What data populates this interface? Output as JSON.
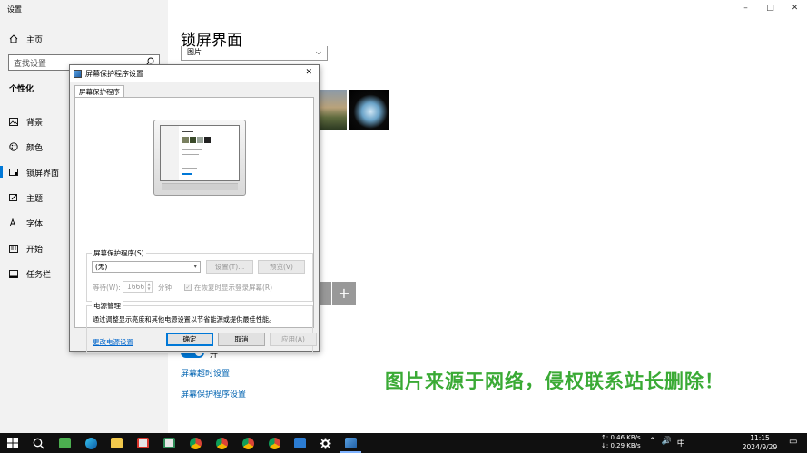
{
  "settings": {
    "window_title": "设置",
    "home": "主页",
    "search_placeholder": "查找设置",
    "section": "个性化",
    "nav": [
      {
        "label": "背景",
        "icon": "image-icon"
      },
      {
        "label": "颜色",
        "icon": "palette-icon"
      },
      {
        "label": "锁屏界面",
        "icon": "lock-screen-icon",
        "active": true
      },
      {
        "label": "主题",
        "icon": "brush-icon"
      },
      {
        "label": "字体",
        "icon": "font-icon"
      },
      {
        "label": "开始",
        "icon": "start-icon"
      },
      {
        "label": "任务栏",
        "icon": "taskbar-icon"
      }
    ],
    "page_title": "锁屏界面",
    "background_value": "图片",
    "toggle_label": "开",
    "link_timeout": "屏幕超时设置",
    "link_screensaver": "屏幕保护程序设置",
    "window_controls": {
      "minimize": "–",
      "maximize": "□",
      "close": "✕"
    }
  },
  "dialog": {
    "title": "屏幕保护程序设置",
    "close": "✕",
    "tab": "屏幕保护程序",
    "screensaver_group": "屏幕保护程序(S)",
    "screensaver_value": "(无)",
    "settings_button": "设置(T)...",
    "preview_button": "预览(V)",
    "wait_label": "等待(W):",
    "wait_value": "1666",
    "wait_unit": "分钟",
    "logon_label": "在恢复时显示登录屏幕(R)",
    "power_group": "电源管理",
    "power_desc": "通过调整显示亮度和其他电源设置以节省能源或提供最佳性能。",
    "power_link": "更改电源设置",
    "ok": "确定",
    "cancel": "取消",
    "apply": "应用(A)"
  },
  "watermark": "图片来源于网络，侵权联系站长删除！",
  "taskbar": {
    "net_up": "↑: 0.46 KB/s",
    "net_down": "↓: 0.29 KB/s",
    "tray": [
      "^",
      "🔊",
      "中"
    ],
    "time": "11:15",
    "date": "2024/9/29",
    "notification": "▭"
  },
  "colors": {
    "accent": "#0078d7",
    "link": "#0063b1",
    "watermark": "#3aaa35",
    "taskbar": "#101010"
  }
}
